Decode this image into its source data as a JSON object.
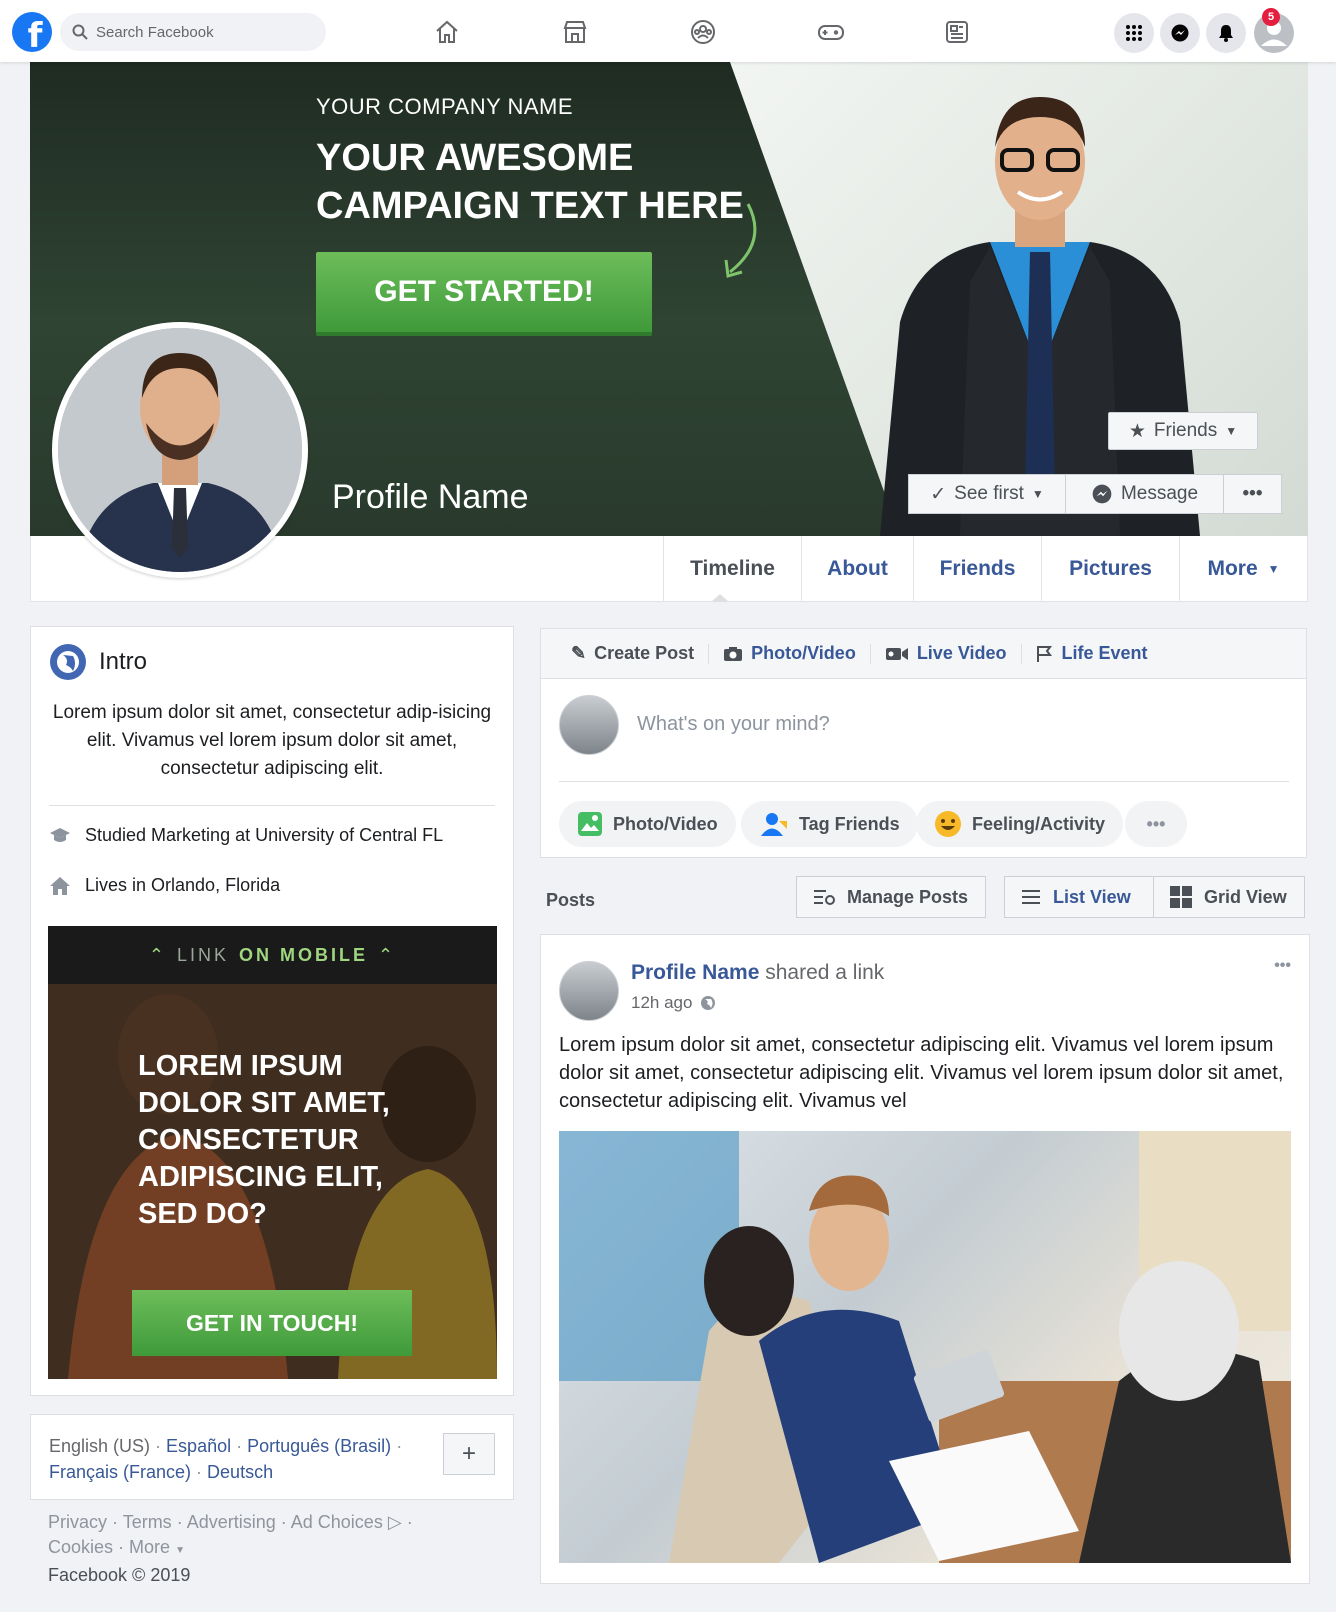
{
  "nav": {
    "search_placeholder": "Search Facebook",
    "notification_count": "5",
    "icons": [
      "home-icon",
      "marketplace-icon",
      "groups-icon",
      "gaming-icon",
      "news-icon",
      "apps-grid-icon",
      "messenger-icon",
      "bell-icon",
      "profile-icon"
    ]
  },
  "cover": {
    "company": "YOUR COMPANY NAME",
    "campaign_line1": "YOUR AWESOME",
    "campaign_line2": "CAMPAIGN TEXT HERE",
    "cta": "GET STARTED!",
    "profile_name": "Profile Name",
    "friends_button": "Friends",
    "see_first_button": "See first",
    "message_button": "Message"
  },
  "tabs": [
    "Timeline",
    "About",
    "Friends",
    "Pictures",
    "More"
  ],
  "intro": {
    "title": "Intro",
    "bio": "Lorem ipsum dolor sit amet, consectetur adip-isicing elit.  Vivamus vel lorem ipsum dolor sit amet, consectetur adipiscing elit.",
    "studied": "Studied Marketing at University of Central FL",
    "lives": "Lives in Orlando, Florida"
  },
  "mobile_ad": {
    "header_a": "LINK",
    "header_b": "ON MOBILE",
    "headline_l1": "LOREM IPSUM",
    "headline_l2": "DOLOR SIT AMET,",
    "headline_l3": "CONSECTETUR",
    "headline_l4": "ADIPISCING ELIT,",
    "headline_l5": "SED DO?",
    "cta": "GET IN TOUCH!"
  },
  "languages": {
    "current": "English (US)",
    "others": [
      "Español",
      "Português (Brasil)",
      "Français (France)",
      "Deutsch"
    ],
    "add_label": "+"
  },
  "footer": {
    "links": [
      "Privacy",
      "Terms",
      "Advertising",
      "Ad Choices",
      "Cookies",
      "More"
    ],
    "copyright": "Facebook © 2019"
  },
  "composer": {
    "tabs": [
      "Create Post",
      "Photo/Video",
      "Live Video",
      "Life Event"
    ],
    "placeholder": "What's on your mind?",
    "actions": [
      "Photo/Video",
      "Tag Friends",
      "Feeling/Activity"
    ]
  },
  "posts_bar": {
    "label": "Posts",
    "manage": "Manage Posts",
    "list_view": "List View",
    "grid_view": "Grid View"
  },
  "post": {
    "author": "Profile Name",
    "action": "shared a link",
    "time": "12h ago",
    "text": "Lorem ipsum dolor sit amet, consectetur adipiscing elit.  Vivamus vel lorem ipsum dolor sit amet, consectetur adipiscing elit.  Vivamus vel lorem ipsum dolor sit amet, consectetur adipiscing elit.  Vivamus vel"
  },
  "colors": {
    "brand_blue": "#1877f2",
    "link_blue": "#385898",
    "cta_green": "#4fa845",
    "badge_red": "#e41e3f"
  }
}
